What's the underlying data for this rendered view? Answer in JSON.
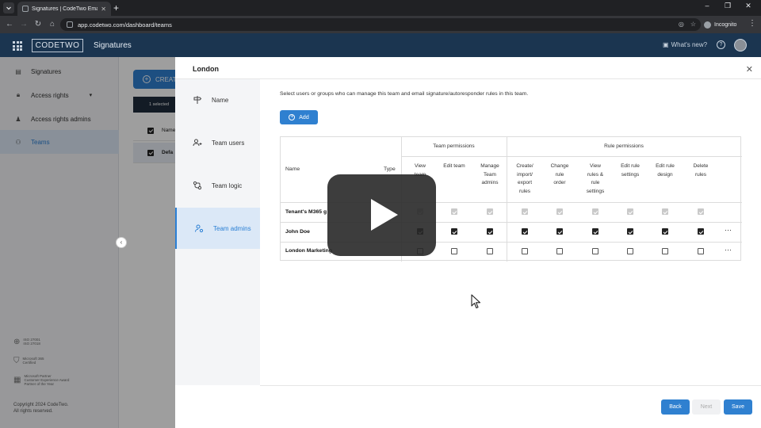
{
  "browser": {
    "tab_title": "Signatures | CodeTwo Email Sig...",
    "url": "app.codetwo.com/dashboard/teams",
    "incognito_label": "Incognito"
  },
  "app": {
    "logo_text": "CODETWO",
    "section_title": "Signatures",
    "whats_new": "What's new?"
  },
  "sidebar": {
    "items": [
      {
        "label": "Signatures"
      },
      {
        "label": "Access rights"
      },
      {
        "label": "Access rights admins"
      },
      {
        "label": "Teams"
      }
    ],
    "certs": [
      {
        "text": "ISO 27001\nISO 27018"
      },
      {
        "text": "Microsoft 365\nCertified"
      },
      {
        "text": "Microsoft Partner\nCustomer Experience Award\nPartner of the Year"
      }
    ],
    "copyright_line1": "Copyright 2024 CodeTwo.",
    "copyright_line2": "All rights reserved."
  },
  "background": {
    "create_label": "CREATE",
    "selected_label": "1 selected",
    "name_header": "Name",
    "row_label": "Defa"
  },
  "dialog": {
    "title": "London",
    "steps": [
      {
        "label": "Name"
      },
      {
        "label": "Team users"
      },
      {
        "label": "Team logic"
      },
      {
        "label": "Team admins"
      }
    ],
    "intro": "Select users or groups who can manage this team and email signature/autoresponder rules in this team.",
    "add_label": "Add",
    "table": {
      "col_name": "Name",
      "col_type": "Type",
      "group_team": "Team permissions",
      "group_rule": "Rule permissions",
      "team_cols": [
        "View\nteam",
        "Edit team",
        "Manage\nTeam\nadmins"
      ],
      "rule_cols": [
        "Create/\nimport/\nexport\nrules",
        "Change\nrule\norder",
        "View\nrules &\nrule\nsettings",
        "Edit rule\nsettings",
        "Edit rule\ndesign",
        "Delete\nrules"
      ],
      "rows": [
        {
          "name": "Tenant's M365 g",
          "type": "",
          "checked": [
            true,
            true,
            true,
            true,
            true,
            true,
            true,
            true,
            true
          ],
          "disabled": true,
          "menu": false
        },
        {
          "name": "John Doe",
          "type": "",
          "checked": [
            true,
            true,
            true,
            true,
            true,
            true,
            true,
            true,
            true
          ],
          "disabled": false,
          "menu": true
        },
        {
          "name": "London Marketing",
          "type": "",
          "checked": [
            false,
            false,
            false,
            false,
            false,
            false,
            false,
            false,
            false
          ],
          "disabled": false,
          "menu": true
        }
      ]
    },
    "buttons": {
      "back": "Back",
      "next": "Next",
      "save": "Save"
    }
  },
  "colors": {
    "accent": "#2f80d0",
    "header": "#1b3550",
    "active_step_bg": "#dbe8f7"
  },
  "icons": {
    "name_step": "signpost-icon",
    "users_step": "users-icon",
    "logic_step": "logic-icon",
    "admins_step": "admin-icon"
  }
}
